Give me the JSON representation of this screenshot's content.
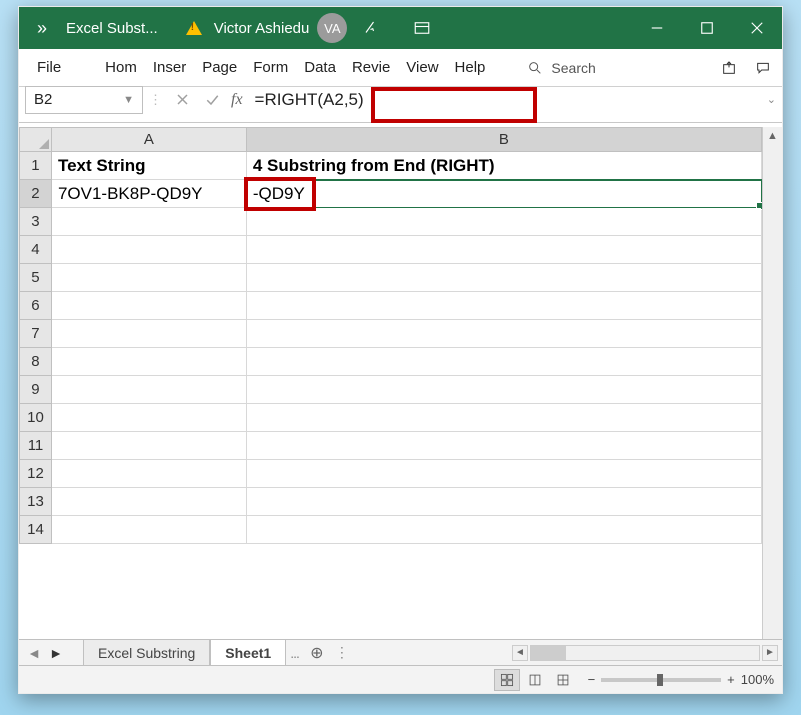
{
  "title": {
    "file_name": "Excel Subst...",
    "user_name": "Victor Ashiedu",
    "user_initials": "VA"
  },
  "menu": {
    "file": "File",
    "home": "Hom",
    "insert": "Inser",
    "page": "Page",
    "formulas": "Form",
    "data": "Data",
    "review": "Revie",
    "view": "View",
    "help": "Help",
    "search": "Search"
  },
  "formula_bar": {
    "cell_ref": "B2",
    "fx_label": "fx",
    "formula": "=RIGHT(A2,5)"
  },
  "columns": [
    "A",
    "B"
  ],
  "rows": [
    "1",
    "2",
    "3",
    "4",
    "5",
    "6",
    "7",
    "8",
    "9",
    "10",
    "11",
    "12",
    "13",
    "14"
  ],
  "cells": {
    "A1": "Text String",
    "B1": "4 Substring from End (RIGHT)",
    "A2": "7OV1-BK8P-QD9Y",
    "B2": "-QD9Y"
  },
  "tabs": {
    "prev": "◄",
    "next": "►",
    "tab1": "Excel Substring",
    "tab2": "Sheet1",
    "more": "...",
    "add": "+"
  },
  "status": {
    "zoom": "100%",
    "minus": "−",
    "plus": "+"
  }
}
